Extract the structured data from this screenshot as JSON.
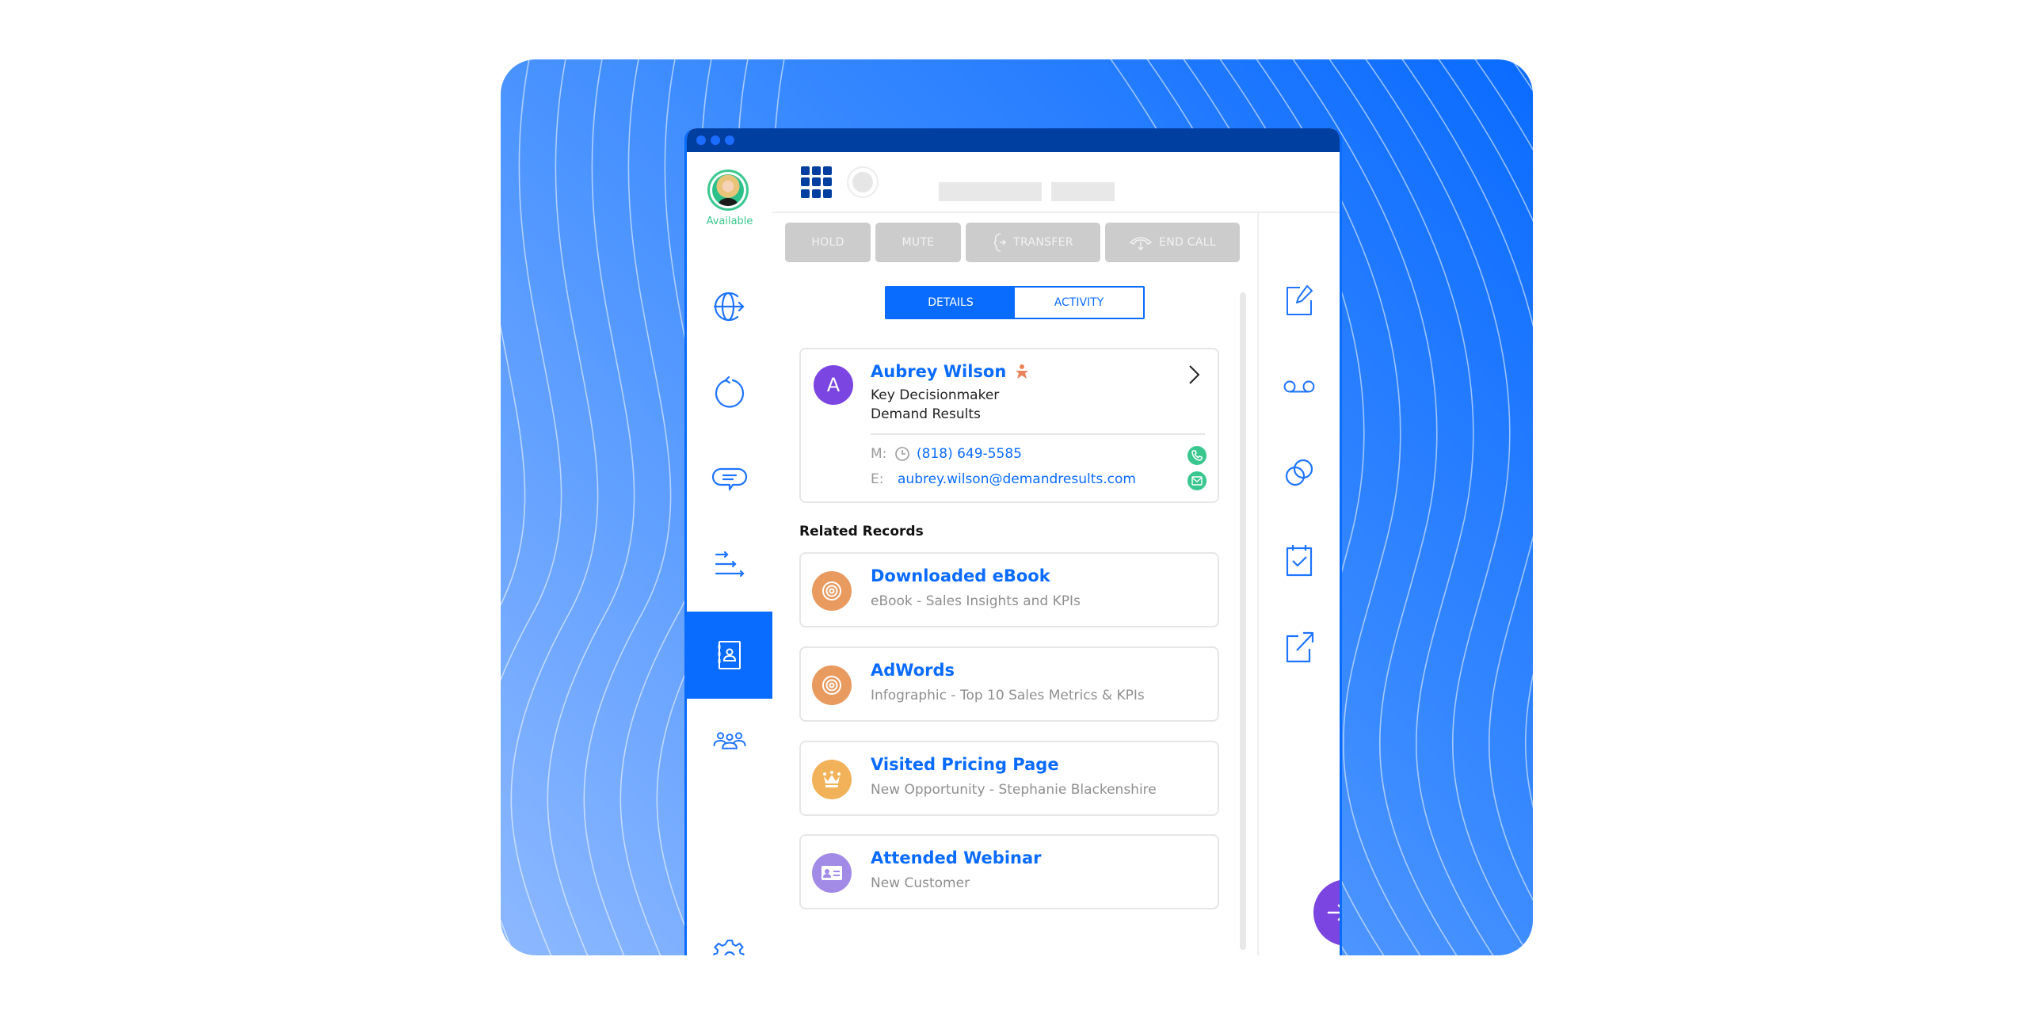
{
  "colors": {
    "brand_blue": "#0a6bff",
    "navy": "#003e9f",
    "available_green": "#3ac78f",
    "purple": "#7a45e0",
    "orange": "#e89a5f",
    "gold": "#f1b25a",
    "lavender": "#a18be6",
    "button_gray": "#cccccc"
  },
  "agent": {
    "status": "Available"
  },
  "sidebar": {
    "items": [
      {
        "icon": "globe-icon",
        "label": "Web"
      },
      {
        "icon": "refresh-icon",
        "label": "Recent"
      },
      {
        "icon": "chat-icon",
        "label": "Messages"
      },
      {
        "icon": "routing-icon",
        "label": "Routing"
      },
      {
        "icon": "contacts-book-icon",
        "label": "Contacts",
        "active": true
      },
      {
        "icon": "team-icon",
        "label": "Team"
      }
    ],
    "settings_icon": "gear-icon"
  },
  "call_controls": [
    {
      "label": "HOLD"
    },
    {
      "label": "MUTE"
    },
    {
      "label": "TRANSFER",
      "icon": "transfer-icon"
    },
    {
      "label": "END CALL",
      "icon": "end-call-icon"
    }
  ],
  "tabs": [
    {
      "label": "DETAILS",
      "active": true
    },
    {
      "label": "ACTIVITY",
      "active": false
    }
  ],
  "contact": {
    "initial": "A",
    "name": "Aubrey Wilson",
    "role": "Key Decisionmaker",
    "company": "Demand Results",
    "mobile_label": "M:",
    "mobile": "(818) 649-5585",
    "email_label": "E:",
    "email": "aubrey.wilson@demandresults.com"
  },
  "related_records": {
    "title": "Related Records",
    "items": [
      {
        "title": "Downloaded eBook",
        "subtitle": "eBook - Sales Insights and KPIs",
        "icon": "target-icon",
        "color": "#e89a5f"
      },
      {
        "title": "AdWords",
        "subtitle": "Infographic - Top 10 Sales Metrics & KPIs",
        "icon": "target-icon",
        "color": "#e89a5f"
      },
      {
        "title": "Visited Pricing Page",
        "subtitle": "New Opportunity - Stephanie Blackenshire",
        "icon": "crown-icon",
        "color": "#f1b25a"
      },
      {
        "title": "Attended Webinar",
        "subtitle": "New Customer",
        "icon": "id-card-icon",
        "color": "#a18be6"
      }
    ]
  },
  "right_rail": [
    {
      "icon": "edit-note-icon",
      "label": "Notes"
    },
    {
      "icon": "voicemail-icon",
      "label": "Voicemail"
    },
    {
      "icon": "link-circles-icon",
      "label": "Associate"
    },
    {
      "icon": "calendar-check-icon",
      "label": "Tasks"
    },
    {
      "icon": "external-link-icon",
      "label": "Open"
    }
  ]
}
